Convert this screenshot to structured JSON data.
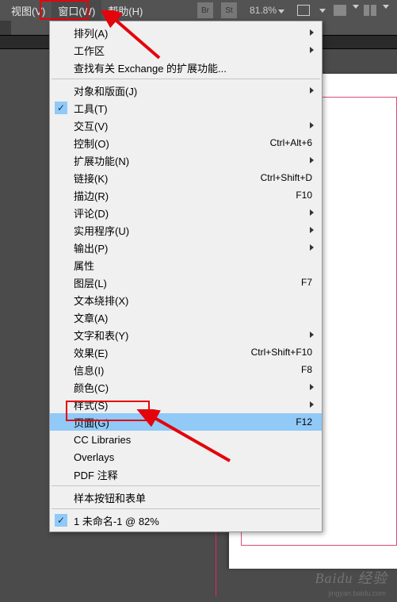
{
  "menubar": {
    "items": [
      {
        "label": "视图(V)"
      },
      {
        "label": "窗口(W)"
      },
      {
        "label": "帮助(H)"
      }
    ],
    "active_index": 1
  },
  "toolbar": {
    "br_icon": "Br",
    "st_icon": "St",
    "zoom": "81.8%"
  },
  "dropdown": {
    "groups": [
      [
        {
          "label": "排列(A)",
          "arrow": true
        },
        {
          "label": "工作区",
          "arrow": true
        },
        {
          "label": "查找有关 Exchange 的扩展功能..."
        }
      ],
      [
        {
          "label": "对象和版面(J)",
          "arrow": true
        },
        {
          "label": "工具(T)",
          "checked": true
        },
        {
          "label": "交互(V)",
          "arrow": true
        },
        {
          "label": "控制(O)",
          "shortcut": "Ctrl+Alt+6"
        },
        {
          "label": "扩展功能(N)",
          "arrow": true
        },
        {
          "label": "链接(K)",
          "shortcut": "Ctrl+Shift+D"
        },
        {
          "label": "描边(R)",
          "shortcut": "F10"
        },
        {
          "label": "评论(D)",
          "arrow": true
        },
        {
          "label": "实用程序(U)",
          "arrow": true
        },
        {
          "label": "输出(P)",
          "arrow": true
        },
        {
          "label": "属性"
        },
        {
          "label": "图层(L)",
          "shortcut": "F7"
        },
        {
          "label": "文本绕排(X)"
        },
        {
          "label": "文章(A)"
        },
        {
          "label": "文字和表(Y)",
          "arrow": true
        },
        {
          "label": "效果(E)",
          "shortcut": "Ctrl+Shift+F10"
        },
        {
          "label": "信息(I)",
          "shortcut": "F8"
        },
        {
          "label": "颜色(C)",
          "arrow": true
        },
        {
          "label": "样式(S)",
          "arrow": true
        },
        {
          "label": "页面(G)",
          "shortcut": "F12",
          "highlight": true
        },
        {
          "label": "CC Libraries"
        },
        {
          "label": "Overlays"
        },
        {
          "label": "PDF 注释"
        }
      ],
      [
        {
          "label": "样本按钮和表单"
        }
      ],
      [
        {
          "label": "1 未命名-1 @ 82%",
          "checked": true
        }
      ]
    ]
  },
  "watermark": {
    "main": "Baidu 经验",
    "sub": "jingyan.baidu.com"
  }
}
